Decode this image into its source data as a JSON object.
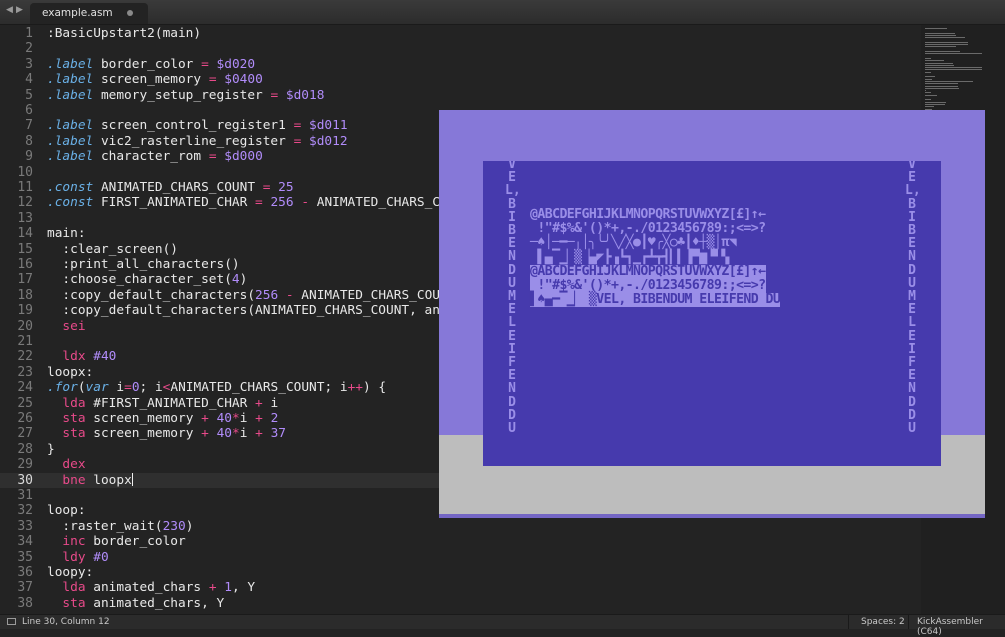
{
  "tabbar": {
    "back_icon": "◀",
    "forward_icon": "▶",
    "tab_label": "example.asm"
  },
  "editor": {
    "current_line": 30,
    "lines": [
      {
        "n": "1",
        "tokens": [
          {
            "t": ":BasicUpstart2(main)"
          }
        ]
      },
      {
        "n": "2",
        "tokens": []
      },
      {
        "n": "3",
        "tokens": [
          {
            "t": ".label",
            "c": "kw"
          },
          {
            "t": " border_color "
          },
          {
            "t": "=",
            "c": "op"
          },
          {
            "t": " "
          },
          {
            "t": "$d020",
            "c": "num"
          }
        ]
      },
      {
        "n": "4",
        "tokens": [
          {
            "t": ".label",
            "c": "kw"
          },
          {
            "t": " screen_memory "
          },
          {
            "t": "=",
            "c": "op"
          },
          {
            "t": " "
          },
          {
            "t": "$0400",
            "c": "num"
          }
        ]
      },
      {
        "n": "5",
        "tokens": [
          {
            "t": ".label",
            "c": "kw"
          },
          {
            "t": " memory_setup_register "
          },
          {
            "t": "=",
            "c": "op"
          },
          {
            "t": " "
          },
          {
            "t": "$d018",
            "c": "num"
          }
        ]
      },
      {
        "n": "6",
        "tokens": []
      },
      {
        "n": "7",
        "tokens": [
          {
            "t": ".label",
            "c": "kw"
          },
          {
            "t": " screen_control_register1 "
          },
          {
            "t": "=",
            "c": "op"
          },
          {
            "t": " "
          },
          {
            "t": "$d011",
            "c": "num"
          }
        ]
      },
      {
        "n": "8",
        "tokens": [
          {
            "t": ".label",
            "c": "kw"
          },
          {
            "t": " vic2_rasterline_register "
          },
          {
            "t": "=",
            "c": "op"
          },
          {
            "t": " "
          },
          {
            "t": "$d012",
            "c": "num"
          }
        ]
      },
      {
        "n": "9",
        "tokens": [
          {
            "t": ".label",
            "c": "kw"
          },
          {
            "t": " character_rom "
          },
          {
            "t": "=",
            "c": "op"
          },
          {
            "t": " "
          },
          {
            "t": "$d000",
            "c": "num"
          }
        ]
      },
      {
        "n": "10",
        "tokens": []
      },
      {
        "n": "11",
        "tokens": [
          {
            "t": ".const",
            "c": "kw"
          },
          {
            "t": " ANIMATED_CHARS_COUNT "
          },
          {
            "t": "=",
            "c": "op"
          },
          {
            "t": " "
          },
          {
            "t": "25",
            "c": "num"
          }
        ]
      },
      {
        "n": "12",
        "tokens": [
          {
            "t": ".const",
            "c": "kw"
          },
          {
            "t": " FIRST_ANIMATED_CHAR "
          },
          {
            "t": "=",
            "c": "op"
          },
          {
            "t": " "
          },
          {
            "t": "256",
            "c": "num"
          },
          {
            "t": " "
          },
          {
            "t": "-",
            "c": "op"
          },
          {
            "t": " ANIMATED_CHARS_CO"
          }
        ]
      },
      {
        "n": "13",
        "tokens": []
      },
      {
        "n": "14",
        "tokens": [
          {
            "t": "main:"
          }
        ]
      },
      {
        "n": "15",
        "tokens": [
          {
            "t": "  :clear_screen()"
          }
        ]
      },
      {
        "n": "16",
        "tokens": [
          {
            "t": "  :print_all_characters()"
          }
        ]
      },
      {
        "n": "17",
        "tokens": [
          {
            "t": "  :choose_character_set("
          },
          {
            "t": "4",
            "c": "num"
          },
          {
            "t": ")"
          }
        ]
      },
      {
        "n": "18",
        "tokens": [
          {
            "t": "  :copy_default_characters("
          },
          {
            "t": "256",
            "c": "num"
          },
          {
            "t": " "
          },
          {
            "t": "-",
            "c": "op"
          },
          {
            "t": " ANIMATED_CHARS_COUN"
          }
        ]
      },
      {
        "n": "19",
        "tokens": [
          {
            "t": "  :copy_default_characters(ANIMATED_CHARS_COUNT, ani"
          }
        ]
      },
      {
        "n": "20",
        "tokens": [
          {
            "t": "  "
          },
          {
            "t": "sei",
            "c": "ins"
          }
        ]
      },
      {
        "n": "21",
        "tokens": []
      },
      {
        "n": "22",
        "tokens": [
          {
            "t": "  "
          },
          {
            "t": "ldx",
            "c": "ins"
          },
          {
            "t": " "
          },
          {
            "t": "#40",
            "c": "num"
          }
        ]
      },
      {
        "n": "23",
        "tokens": [
          {
            "t": "loopx:"
          }
        ]
      },
      {
        "n": "24",
        "tokens": [
          {
            "t": ".for",
            "c": "kw"
          },
          {
            "t": "("
          },
          {
            "t": "var",
            "c": "kw"
          },
          {
            "t": " i"
          },
          {
            "t": "=",
            "c": "op"
          },
          {
            "t": "0",
            "c": "num"
          },
          {
            "t": "; i"
          },
          {
            "t": "<",
            "c": "op"
          },
          {
            "t": "ANIMATED_CHARS_COUNT; i"
          },
          {
            "t": "++",
            "c": "op"
          },
          {
            "t": ") {"
          }
        ]
      },
      {
        "n": "25",
        "tokens": [
          {
            "t": "  "
          },
          {
            "t": "lda",
            "c": "ins"
          },
          {
            "t": " #FIRST_ANIMATED_CHAR "
          },
          {
            "t": "+",
            "c": "op"
          },
          {
            "t": " i"
          }
        ]
      },
      {
        "n": "26",
        "tokens": [
          {
            "t": "  "
          },
          {
            "t": "sta",
            "c": "ins"
          },
          {
            "t": " screen_memory "
          },
          {
            "t": "+",
            "c": "op"
          },
          {
            "t": " "
          },
          {
            "t": "40",
            "c": "num"
          },
          {
            "t": "*",
            "c": "op"
          },
          {
            "t": "i "
          },
          {
            "t": "+",
            "c": "op"
          },
          {
            "t": " "
          },
          {
            "t": "2",
            "c": "num"
          }
        ]
      },
      {
        "n": "27",
        "tokens": [
          {
            "t": "  "
          },
          {
            "t": "sta",
            "c": "ins"
          },
          {
            "t": " screen_memory "
          },
          {
            "t": "+",
            "c": "op"
          },
          {
            "t": " "
          },
          {
            "t": "40",
            "c": "num"
          },
          {
            "t": "*",
            "c": "op"
          },
          {
            "t": "i "
          },
          {
            "t": "+",
            "c": "op"
          },
          {
            "t": " "
          },
          {
            "t": "37",
            "c": "num"
          }
        ]
      },
      {
        "n": "28",
        "tokens": [
          {
            "t": "}"
          }
        ]
      },
      {
        "n": "29",
        "tokens": [
          {
            "t": "  "
          },
          {
            "t": "dex",
            "c": "ins"
          }
        ]
      },
      {
        "n": "30",
        "tokens": [
          {
            "t": "  "
          },
          {
            "t": "bne",
            "c": "ins"
          },
          {
            "t": " loopx"
          }
        ]
      },
      {
        "n": "31",
        "tokens": []
      },
      {
        "n": "32",
        "tokens": [
          {
            "t": "loop:"
          }
        ]
      },
      {
        "n": "33",
        "tokens": [
          {
            "t": "  :raster_wait("
          },
          {
            "t": "230",
            "c": "num"
          },
          {
            "t": ")"
          }
        ]
      },
      {
        "n": "34",
        "tokens": [
          {
            "t": "  "
          },
          {
            "t": "inc",
            "c": "ins"
          },
          {
            "t": " border_color"
          }
        ]
      },
      {
        "n": "35",
        "tokens": [
          {
            "t": "  "
          },
          {
            "t": "ldy",
            "c": "ins"
          },
          {
            "t": " "
          },
          {
            "t": "#0",
            "c": "num"
          }
        ]
      },
      {
        "n": "36",
        "tokens": [
          {
            "t": "loopy:"
          }
        ]
      },
      {
        "n": "37",
        "tokens": [
          {
            "t": "  "
          },
          {
            "t": "lda",
            "c": "ins"
          },
          {
            "t": " animated_chars "
          },
          {
            "t": "+",
            "c": "op"
          },
          {
            "t": " "
          },
          {
            "t": "1",
            "c": "num"
          },
          {
            "t": ", Y"
          }
        ]
      },
      {
        "n": "38",
        "tokens": [
          {
            "t": "  "
          },
          {
            "t": "sta",
            "c": "ins"
          },
          {
            "t": " animated_chars, Y"
          }
        ]
      }
    ]
  },
  "emulator": {
    "colors": {
      "border": "#8678d8",
      "screen": "#463aad",
      "text": "#9a8ee8",
      "bottom": "#bdbdbd"
    },
    "left_column": "VEL, BIBENDUM ELEIFEND DU",
    "right_column": "VEL, BIBENDUM ELEIFEND DU",
    "char_rows": [
      {
        "text": "@ABCDEFGHIJKLMNOPQRSTUVWXYZ[£]↑←",
        "rev": false
      },
      {
        "text": " !\"#$%&'()*+,-./0123456789:;<=>?",
        "rev": false
      },
      {
        "text": "─♠│─━─╷│╮╰╯╲╱╳●┃♥╭╳○♣┃♦┼▒│π◥",
        "rev": false
      },
      {
        "text": " ▌▄▔▁▏▒▕▄◤┣▗┗┓▁┏┻┳┫▎▍▐▀▆▝▘▚",
        "rev": false
      },
      {
        "text": "@ABCDEFGHIJKLMNOPQRSTUVWXYZ[£]↑←",
        "rev": true
      },
      {
        "text": " !\"#$%&'()*+,-./0123456789:;<=>?",
        "rev": true
      },
      {
        "text": "▌♠▄━▔▁▏ ▒VEL, BIBENDUM ELEIFEND DU",
        "rev": true
      }
    ]
  },
  "statusbar": {
    "position": "Line 30, Column 12",
    "spaces": "Spaces: 2",
    "syntax": "KickAssembler (C64)"
  }
}
